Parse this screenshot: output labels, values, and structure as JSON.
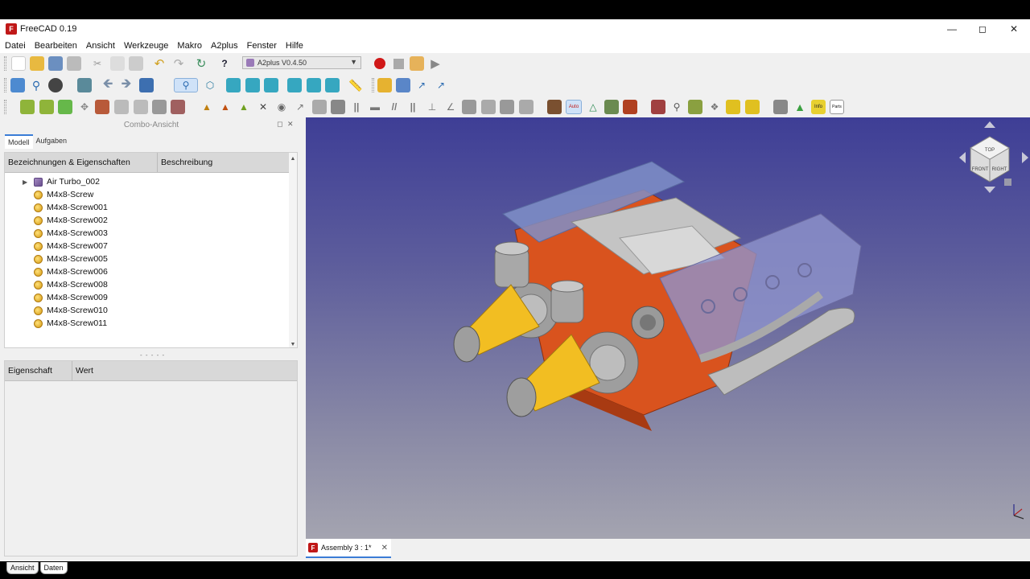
{
  "window": {
    "title": "FreeCAD 0.19",
    "app_icon_letter": "F"
  },
  "menu": [
    "Datei",
    "Bearbeiten",
    "Ansicht",
    "Werkzeuge",
    "Makro",
    "A2plus",
    "Fenster",
    "Hilfe"
  ],
  "workbench_selector": {
    "value": "A2plus V0.4.50"
  },
  "combo_view": {
    "title": "Combo-Ansicht",
    "tabs": [
      "Modell",
      "Aufgaben"
    ],
    "tree_headers": [
      "Bezeichnungen & Eigenschaften",
      "Beschreibung"
    ],
    "tree_items": [
      {
        "label": "Air Turbo_002",
        "type": "part",
        "expandable": true
      },
      {
        "label": "M4x8-Screw",
        "type": "screw"
      },
      {
        "label": "M4x8-Screw001",
        "type": "screw"
      },
      {
        "label": "M4x8-Screw002",
        "type": "screw"
      },
      {
        "label": "M4x8-Screw003",
        "type": "screw"
      },
      {
        "label": "M4x8-Screw007",
        "type": "screw"
      },
      {
        "label": "M4x8-Screw005",
        "type": "screw"
      },
      {
        "label": "M4x8-Screw006",
        "type": "screw"
      },
      {
        "label": "M4x8-Screw008",
        "type": "screw"
      },
      {
        "label": "M4x8-Screw009",
        "type": "screw"
      },
      {
        "label": "M4x8-Screw010",
        "type": "screw"
      },
      {
        "label": "M4x8-Screw011",
        "type": "screw"
      }
    ],
    "property_headers": [
      "Eigenschaft",
      "Wert"
    ],
    "bottom_tabs": [
      "Ansicht",
      "Daten"
    ]
  },
  "document_tab": {
    "label": "Assembly 3 : 1*"
  },
  "navicube": {
    "faces": [
      "TOP",
      "FRONT",
      "RIGHT"
    ]
  },
  "colors": {
    "viewport_top": "#3e3e96",
    "viewport_bottom": "#a4a4b0",
    "engine_block": "#d9531e",
    "filter_yellow": "#f2be22",
    "accent_tab": "#3a7cd6",
    "record_button": "#d01818"
  }
}
